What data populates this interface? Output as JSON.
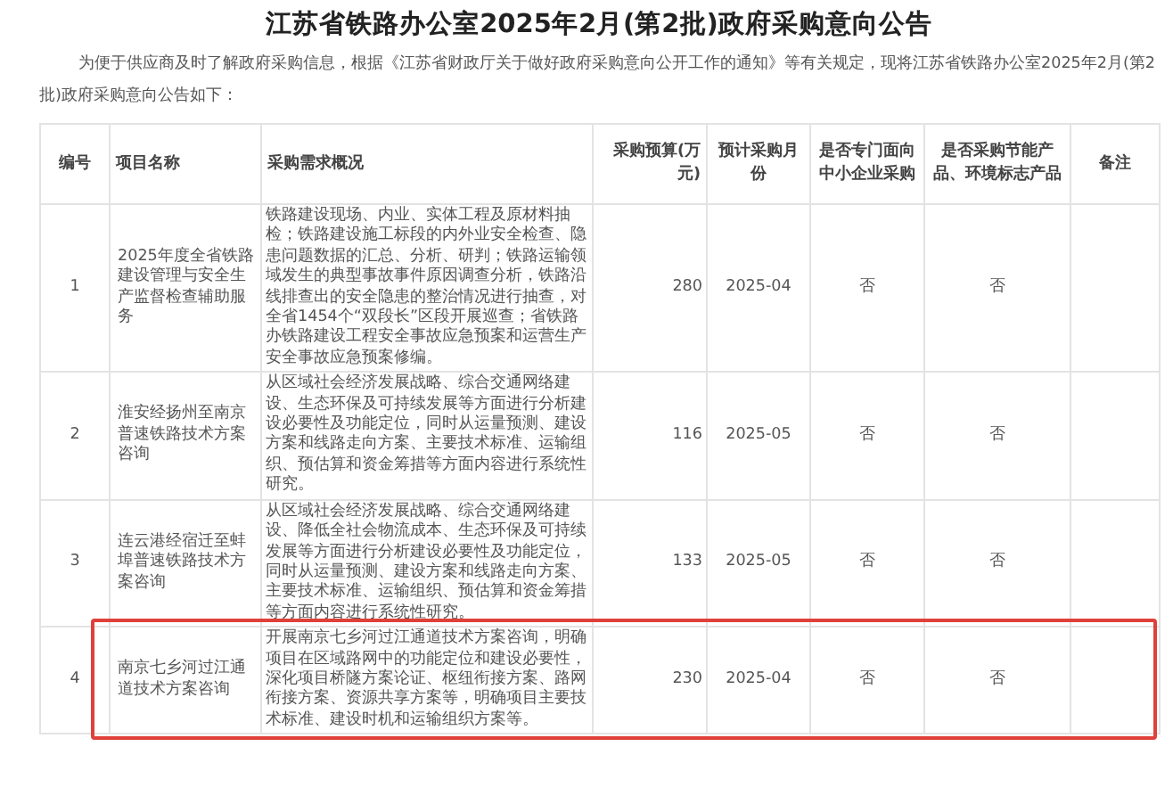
{
  "title": "江苏省铁路办公室2025年2月(第2批)政府采购意向公告",
  "intro": "为便于供应商及时了解政府采购信息，根据《江苏省财政厅关于做好政府采购意向公开工作的通知》等有关规定，现将江苏省铁路办公室2025年2月(第2批)政府采购意向公告如下：",
  "table": {
    "columns": [
      "编号",
      "项目名称",
      "采购需求概况",
      "采购预算(万元)",
      "预计采购月份",
      "是否专门面向中小企业采购",
      "是否采购节能产品、环境标志产品",
      "备注"
    ],
    "rows": [
      {
        "number": "1",
        "name": "2025年度全省铁路建设管理与安全生产监督检查辅助服务",
        "summary": "铁路建设现场、内业、实体工程及原材料抽检；铁路建设施工标段的内外业安全检查、隐患问题数据的汇总、分析、研判；铁路运输领域发生的典型事故事件原因调查分析，铁路沿线排查出的安全隐患的整治情况进行抽查，对全省1454个“双段长”区段开展巡查；省铁路办铁路建设工程安全事故应急预案和运营生产安全事故应急预案修编。",
        "budget": "280",
        "month": "2025-04",
        "sme": "否",
        "green": "否",
        "highlighted": false
      },
      {
        "number": "2",
        "name": "淮安经扬州至南京普速铁路技术方案咨询",
        "summary": "从区域社会经济发展战略、综合交通网络建设、生态环保及可持续发展等方面进行分析建设必要性及功能定位，同时从运量预测、建设方案和线路走向方案、主要技术标准、运输组织、预估算和资金筹措等方面内容进行系统性研究。",
        "budget": "116",
        "month": "2025-05",
        "sme": "否",
        "green": "否",
        "highlighted": false
      },
      {
        "number": "3",
        "name": "连云港经宿迁至蚌埠普速铁路技术方案咨询",
        "summary": "从区域社会经济发展战略、综合交通网络建设、降低全社会物流成本、生态环保及可持续发展等方面进行分析建设必要性及功能定位，同时从运量预测、建设方案和线路走向方案、主要技术标准、运输组织、预估算和资金筹措等方面内容进行系统性研究。",
        "budget": "133",
        "month": "2025-05",
        "sme": "否",
        "green": "否",
        "highlighted": false
      },
      {
        "number": "4",
        "name": "南京七乡河过江通道技术方案咨询",
        "summary": "开展南京七乡河过江通道技术方案咨询，明确项目在区域路网中的功能定位和建设必要性，深化项目桥隧方案论证、枢纽衔接方案、路网衔接方案、资源共享方案等，明确项目主要技术标准、建设时机和运输组织方案等。",
        "budget": "230",
        "month": "2025-04",
        "sme": "否",
        "green": "否",
        "highlighted": true
      }
    ]
  }
}
